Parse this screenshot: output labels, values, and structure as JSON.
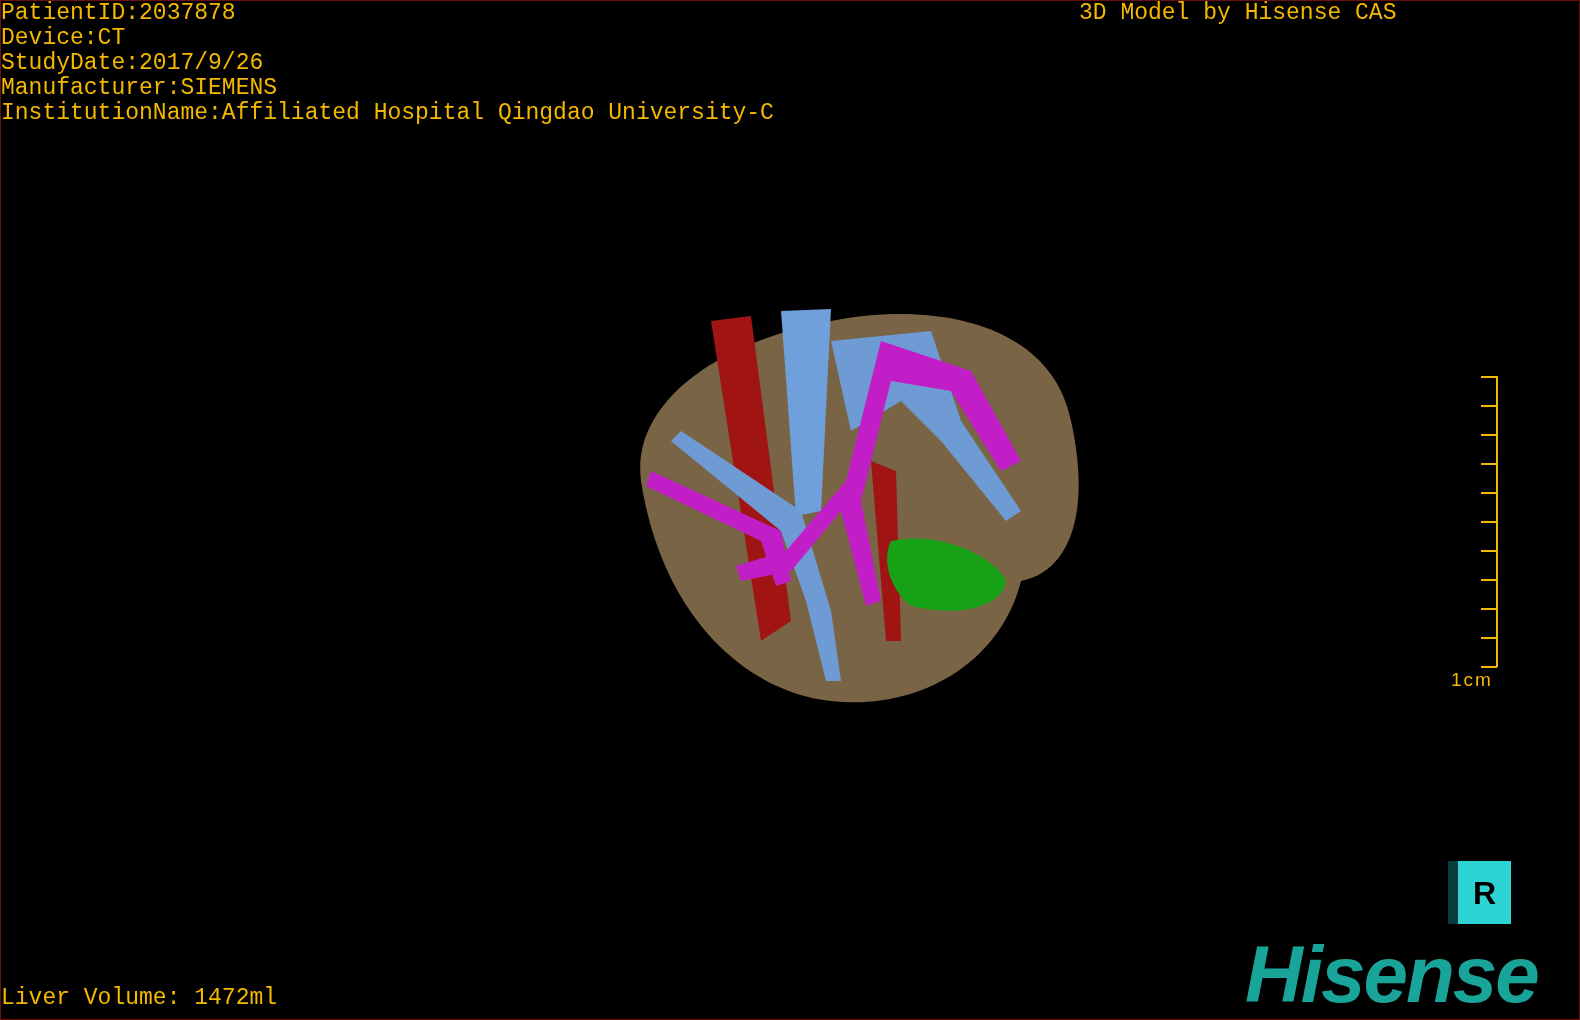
{
  "study_info": [
    "PatientID:2037878",
    "Device:CT",
    "StudyDate:2017/9/26",
    "Manufacturer:SIEMENS",
    "InstitutionName:Affiliated Hospital Qingdao University-C"
  ],
  "title": "3D Model by Hisense CAS",
  "scale_bar": {
    "label": "1cm"
  },
  "orientation_cube": {
    "label": "R"
  },
  "logo": {
    "text": "Hisense"
  },
  "liver_volume": "Liver Volume: 1472ml"
}
